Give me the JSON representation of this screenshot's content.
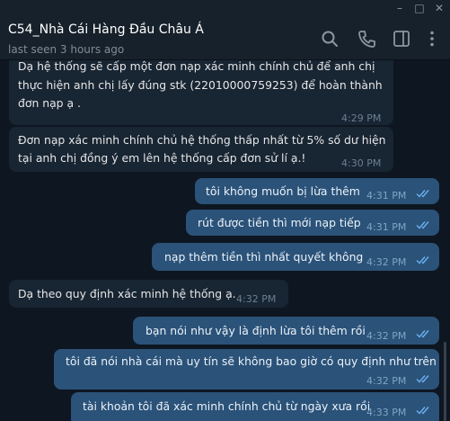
{
  "window": {
    "controls": [
      "minimize-icon",
      "maximize-icon",
      "close-icon"
    ]
  },
  "header": {
    "title": "C54_Nhà Cái Hàng Đầu Châu Á",
    "status": "last seen 3 hours ago",
    "icons": [
      "search-icon",
      "phone-icon",
      "sidebar-icon",
      "more-icon"
    ]
  },
  "messages": [
    {
      "dir": "in",
      "lines": [
        "Dạ hệ thống sẽ cấp một đơn nạp xác minh chính chủ để anh chị",
        "thực hiện anh chị lấy đúng stk (22010000759253) để hoàn thành",
        "đơn nạp ạ ."
      ],
      "time": "4:29 PM"
    },
    {
      "dir": "in",
      "lines": [
        "Đơn nạp xác minh chính chủ hệ thống thấp nhất từ 5% số dư hiện",
        "tại anh chị đồng ý em lên hệ thống cấp đơn sử lí ạ.!"
      ],
      "time": "4:30 PM"
    },
    {
      "dir": "out",
      "lines": [
        "tôi không muốn bị lừa thêm"
      ],
      "time": "4:31 PM"
    },
    {
      "dir": "out",
      "lines": [
        "rút được tiền thì mới nạp tiếp"
      ],
      "time": "4:31 PM"
    },
    {
      "dir": "out",
      "lines": [
        "nạp thêm tiền thì nhất quyết không"
      ],
      "time": "4:32 PM"
    },
    {
      "dir": "in",
      "lines": [
        "Dạ theo quy định xác minh hệ thống ạ."
      ],
      "time": "4:32 PM"
    },
    {
      "dir": "out",
      "lines": [
        "bạn nói như vậy là định lừa tôi thêm rồi"
      ],
      "time": "4:32 PM"
    },
    {
      "dir": "out",
      "lines": [
        "tôi đã nói nhà cái mà uy tín sẽ không bao giờ có quy định như trên"
      ],
      "time": "4:32 PM"
    },
    {
      "dir": "out",
      "lines": [
        "tài khoản tôi đã xác minh chính chủ từ ngày xưa rồi"
      ],
      "time": "4:33 PM"
    }
  ],
  "colors": {
    "background": "#0e1621",
    "header": "#17212b",
    "incoming_bubble": "#182533",
    "outgoing_bubble": "#2b5278",
    "read_tick": "#6ab2f2"
  }
}
